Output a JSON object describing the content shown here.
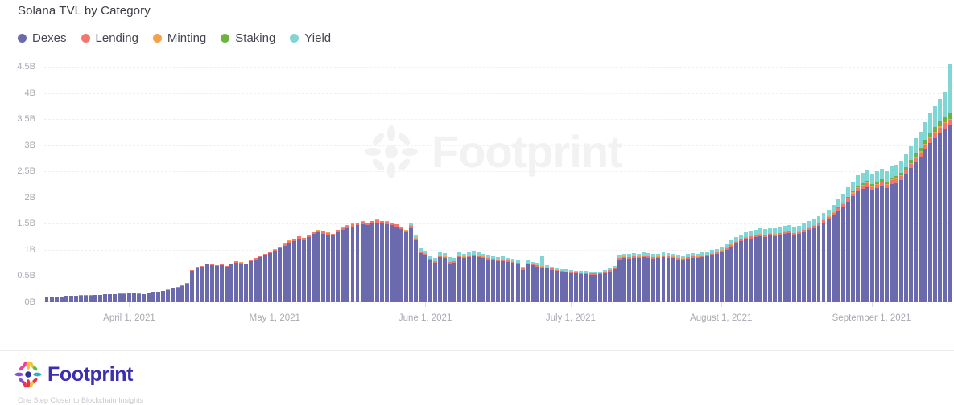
{
  "header": {
    "title": "Solana TVL by Category"
  },
  "legend": {
    "items": [
      {
        "label": "Dexes",
        "color": "#6b6aad"
      },
      {
        "label": "Lending",
        "color": "#f3766e"
      },
      {
        "label": "Minting",
        "color": "#f5a04a"
      },
      {
        "label": "Staking",
        "color": "#6cb33f"
      },
      {
        "label": "Yield",
        "color": "#7fd6d4"
      }
    ]
  },
  "watermark": {
    "text": "Footprint"
  },
  "footer": {
    "brand": "Footprint",
    "tagline": "One Step Closer to Blockchain Insights",
    "brand_color": "#3a2fae",
    "logo_colors": [
      "#8a4fd6",
      "#e8459b",
      "#f2c230",
      "#e8344a",
      "#2bb3c0",
      "#5bbf4a",
      "#2f2f9e"
    ]
  },
  "chart_data": {
    "type": "bar",
    "stacked": true,
    "title": "Solana TVL by Category",
    "xlabel": "",
    "ylabel": "",
    "ylim": [
      0,
      4500000000
    ],
    "ytick_labels": [
      "0B",
      "0.5B",
      "1B",
      "1.5B",
      "2B",
      "2.5B",
      "3B",
      "3.5B",
      "4B",
      "4.5B"
    ],
    "ytick_values": [
      0,
      500000000,
      1000000000,
      1500000000,
      2000000000,
      2500000000,
      3000000000,
      3500000000,
      4000000000,
      4500000000
    ],
    "grid": true,
    "grid_style": "dashed",
    "legend_position": "top-left",
    "x_tick_labels": [
      "April 1, 2021",
      "May 1, 2021",
      "June 1, 2021",
      "July 1, 2021",
      "August 1, 2021",
      "September 1, 2021"
    ],
    "x_tick_indices": [
      17,
      47,
      78,
      108,
      139,
      170
    ],
    "value_unit": "B",
    "series": [
      {
        "name": "Dexes",
        "color": "#6b6aad",
        "values": [
          0.1,
          0.1,
          0.11,
          0.11,
          0.12,
          0.12,
          0.12,
          0.13,
          0.13,
          0.13,
          0.14,
          0.14,
          0.15,
          0.15,
          0.15,
          0.16,
          0.16,
          0.17,
          0.17,
          0.16,
          0.15,
          0.17,
          0.18,
          0.19,
          0.21,
          0.23,
          0.26,
          0.28,
          0.31,
          0.36,
          0.6,
          0.66,
          0.68,
          0.72,
          0.7,
          0.69,
          0.71,
          0.68,
          0.72,
          0.76,
          0.74,
          0.72,
          0.78,
          0.82,
          0.86,
          0.9,
          0.93,
          0.98,
          1.03,
          1.08,
          1.14,
          1.17,
          1.22,
          1.19,
          1.24,
          1.3,
          1.33,
          1.31,
          1.29,
          1.27,
          1.34,
          1.38,
          1.42,
          1.45,
          1.47,
          1.49,
          1.47,
          1.5,
          1.52,
          1.5,
          1.49,
          1.47,
          1.44,
          1.4,
          1.33,
          1.42,
          1.18,
          0.93,
          0.9,
          0.8,
          0.76,
          0.86,
          0.84,
          0.74,
          0.76,
          0.86,
          0.84,
          0.86,
          0.88,
          0.86,
          0.84,
          0.82,
          0.8,
          0.78,
          0.79,
          0.77,
          0.75,
          0.73,
          0.62,
          0.72,
          0.7,
          0.68,
          0.66,
          0.64,
          0.62,
          0.6,
          0.58,
          0.57,
          0.56,
          0.55,
          0.54,
          0.54,
          0.53,
          0.53,
          0.54,
          0.56,
          0.59,
          0.63,
          0.82,
          0.84,
          0.83,
          0.85,
          0.84,
          0.86,
          0.85,
          0.83,
          0.84,
          0.86,
          0.85,
          0.84,
          0.82,
          0.81,
          0.83,
          0.85,
          0.84,
          0.86,
          0.88,
          0.9,
          0.92,
          0.96,
          1.0,
          1.06,
          1.12,
          1.16,
          1.2,
          1.22,
          1.24,
          1.26,
          1.25,
          1.27,
          1.26,
          1.28,
          1.3,
          1.32,
          1.28,
          1.3,
          1.34,
          1.38,
          1.42,
          1.46,
          1.52,
          1.58,
          1.66,
          1.74,
          1.82,
          1.92,
          2.02,
          2.12,
          2.16,
          2.2,
          2.14,
          2.18,
          2.22,
          2.18,
          2.26,
          2.28,
          2.34,
          2.44,
          2.56,
          2.68,
          2.78,
          2.92,
          3.04,
          3.14,
          3.24,
          3.32,
          3.38
        ]
      },
      {
        "name": "Lending",
        "color": "#f3766e",
        "values": [
          0.004,
          0.004,
          0.004,
          0.004,
          0.004,
          0.004,
          0.004,
          0.004,
          0.004,
          0.004,
          0.004,
          0.004,
          0.005,
          0.005,
          0.005,
          0.005,
          0.005,
          0.005,
          0.005,
          0.005,
          0.005,
          0.005,
          0.006,
          0.006,
          0.006,
          0.007,
          0.007,
          0.008,
          0.008,
          0.009,
          0.012,
          0.013,
          0.014,
          0.015,
          0.015,
          0.015,
          0.016,
          0.015,
          0.016,
          0.017,
          0.017,
          0.016,
          0.018,
          0.019,
          0.02,
          0.021,
          0.022,
          0.024,
          0.026,
          0.028,
          0.03,
          0.031,
          0.033,
          0.032,
          0.034,
          0.036,
          0.038,
          0.037,
          0.036,
          0.035,
          0.038,
          0.04,
          0.042,
          0.044,
          0.045,
          0.046,
          0.045,
          0.047,
          0.048,
          0.047,
          0.046,
          0.045,
          0.044,
          0.042,
          0.04,
          0.043,
          0.036,
          0.028,
          0.027,
          0.024,
          0.023,
          0.026,
          0.025,
          0.022,
          0.023,
          0.026,
          0.025,
          0.026,
          0.027,
          0.026,
          0.025,
          0.025,
          0.024,
          0.023,
          0.024,
          0.023,
          0.022,
          0.022,
          0.019,
          0.022,
          0.021,
          0.02,
          0.02,
          0.019,
          0.019,
          0.018,
          0.017,
          0.017,
          0.017,
          0.016,
          0.016,
          0.016,
          0.016,
          0.016,
          0.016,
          0.017,
          0.018,
          0.019,
          0.025,
          0.025,
          0.025,
          0.026,
          0.025,
          0.026,
          0.026,
          0.025,
          0.025,
          0.026,
          0.026,
          0.025,
          0.025,
          0.024,
          0.025,
          0.026,
          0.025,
          0.026,
          0.027,
          0.027,
          0.028,
          0.029,
          0.03,
          0.032,
          0.034,
          0.035,
          0.036,
          0.037,
          0.037,
          0.038,
          0.038,
          0.038,
          0.038,
          0.038,
          0.039,
          0.04,
          0.038,
          0.039,
          0.04,
          0.041,
          0.043,
          0.044,
          0.046,
          0.047,
          0.05,
          0.052,
          0.055,
          0.058,
          0.061,
          0.064,
          0.065,
          0.066,
          0.064,
          0.065,
          0.067,
          0.065,
          0.068,
          0.068,
          0.07,
          0.073,
          0.077,
          0.08,
          0.083,
          0.088,
          0.091,
          0.094,
          0.097,
          0.1,
          0.101
        ]
      },
      {
        "name": "Minting",
        "color": "#f5a04a",
        "values": [
          0.001,
          0.001,
          0.001,
          0.001,
          0.001,
          0.001,
          0.001,
          0.001,
          0.001,
          0.001,
          0.001,
          0.001,
          0.001,
          0.001,
          0.001,
          0.001,
          0.001,
          0.001,
          0.001,
          0.001,
          0.001,
          0.001,
          0.001,
          0.001,
          0.001,
          0.002,
          0.002,
          0.002,
          0.002,
          0.002,
          0.003,
          0.003,
          0.003,
          0.003,
          0.003,
          0.003,
          0.004,
          0.003,
          0.004,
          0.004,
          0.004,
          0.004,
          0.004,
          0.004,
          0.005,
          0.005,
          0.005,
          0.005,
          0.006,
          0.006,
          0.007,
          0.007,
          0.007,
          0.007,
          0.008,
          0.008,
          0.008,
          0.008,
          0.008,
          0.008,
          0.008,
          0.009,
          0.009,
          0.01,
          0.01,
          0.01,
          0.01,
          0.01,
          0.011,
          0.01,
          0.01,
          0.01,
          0.01,
          0.009,
          0.009,
          0.01,
          0.008,
          0.006,
          0.006,
          0.005,
          0.005,
          0.006,
          0.006,
          0.005,
          0.005,
          0.006,
          0.006,
          0.006,
          0.006,
          0.006,
          0.006,
          0.006,
          0.005,
          0.005,
          0.005,
          0.005,
          0.005,
          0.005,
          0.004,
          0.005,
          0.005,
          0.005,
          0.004,
          0.004,
          0.004,
          0.004,
          0.004,
          0.004,
          0.004,
          0.004,
          0.004,
          0.004,
          0.004,
          0.004,
          0.004,
          0.004,
          0.004,
          0.004,
          0.006,
          0.006,
          0.006,
          0.006,
          0.006,
          0.006,
          0.006,
          0.006,
          0.006,
          0.006,
          0.006,
          0.006,
          0.006,
          0.006,
          0.006,
          0.006,
          0.006,
          0.006,
          0.006,
          0.007,
          0.007,
          0.007,
          0.008,
          0.008,
          0.009,
          0.009,
          0.009,
          0.009,
          0.009,
          0.01,
          0.01,
          0.01,
          0.01,
          0.01,
          0.01,
          0.01,
          0.01,
          0.01,
          0.01,
          0.011,
          0.011,
          0.011,
          0.012,
          0.012,
          0.013,
          0.013,
          0.014,
          0.015,
          0.016,
          0.016,
          0.017,
          0.017,
          0.016,
          0.017,
          0.017,
          0.017,
          0.017,
          0.018,
          0.018,
          0.019,
          0.02,
          0.021,
          0.021,
          0.022,
          0.023,
          0.024,
          0.025,
          0.026,
          0.026
        ]
      },
      {
        "name": "Staking",
        "color": "#6cb33f",
        "values": [
          0.0,
          0.0,
          0.0,
          0.0,
          0.0,
          0.0,
          0.0,
          0.0,
          0.0,
          0.0,
          0.0,
          0.0,
          0.0,
          0.0,
          0.0,
          0.0,
          0.0,
          0.0,
          0.0,
          0.0,
          0.0,
          0.0,
          0.0,
          0.0,
          0.0,
          0.0,
          0.0,
          0.0,
          0.0,
          0.0,
          0.0,
          0.0,
          0.0,
          0.0,
          0.0,
          0.0,
          0.0,
          0.0,
          0.0,
          0.0,
          0.0,
          0.0,
          0.0,
          0.0,
          0.0,
          0.0,
          0.0,
          0.0,
          0.0,
          0.0,
          0.0,
          0.0,
          0.0,
          0.0,
          0.0,
          0.0,
          0.0,
          0.0,
          0.0,
          0.0,
          0.0,
          0.0,
          0.0,
          0.0,
          0.0,
          0.0,
          0.0,
          0.0,
          0.0,
          0.0,
          0.0,
          0.0,
          0.0,
          0.0,
          0.0,
          0.0,
          0.0,
          0.0,
          0.0,
          0.0,
          0.0,
          0.0,
          0.0,
          0.0,
          0.0,
          0.0,
          0.0,
          0.0,
          0.0,
          0.0,
          0.0,
          0.0,
          0.0,
          0.0,
          0.0,
          0.0,
          0.0,
          0.0,
          0.0,
          0.0,
          0.0,
          0.0,
          0.0,
          0.0,
          0.0,
          0.0,
          0.0,
          0.0,
          0.0,
          0.0,
          0.0,
          0.0,
          0.0,
          0.0,
          0.0,
          0.0,
          0.0,
          0.0,
          0.0,
          0.0,
          0.0,
          0.0,
          0.0,
          0.0,
          0.0,
          0.0,
          0.0,
          0.0,
          0.0,
          0.0,
          0.0,
          0.0,
          0.0,
          0.0,
          0.0,
          0.0,
          0.0,
          0.0,
          0.0,
          0.0,
          0.0,
          0.0,
          0.0,
          0.0,
          0.0,
          0.0,
          0.0,
          0.0,
          0.0,
          0.0,
          0.0,
          0.0,
          0.0,
          0.0,
          0.0,
          0.0,
          0.0,
          0.0,
          0.0,
          0.0,
          0.0,
          0.0,
          0.0,
          0.018,
          0.022,
          0.026,
          0.03,
          0.034,
          0.036,
          0.038,
          0.036,
          0.038,
          0.04,
          0.038,
          0.042,
          0.044,
          0.048,
          0.052,
          0.058,
          0.064,
          0.07,
          0.076,
          0.082,
          0.088,
          0.094,
          0.1,
          0.104
        ]
      },
      {
        "name": "Yield",
        "color": "#7fd6d4",
        "values": [
          0.0,
          0.0,
          0.0,
          0.0,
          0.0,
          0.0,
          0.0,
          0.0,
          0.0,
          0.0,
          0.0,
          0.0,
          0.0,
          0.0,
          0.0,
          0.0,
          0.0,
          0.0,
          0.0,
          0.0,
          0.0,
          0.0,
          0.0,
          0.0,
          0.0,
          0.0,
          0.0,
          0.0,
          0.0,
          0.0,
          0.0,
          0.0,
          0.0,
          0.0,
          0.0,
          0.0,
          0.0,
          0.0,
          0.0,
          0.0,
          0.0,
          0.0,
          0.0,
          0.0,
          0.0,
          0.0,
          0.0,
          0.0,
          0.0,
          0.0,
          0.0,
          0.0,
          0.0,
          0.0,
          0.0,
          0.0,
          0.0,
          0.0,
          0.0,
          0.0,
          0.0,
          0.0,
          0.0,
          0.0,
          0.0,
          0.0,
          0.0,
          0.0,
          0.0,
          0.0,
          0.0,
          0.0,
          0.0,
          0.0,
          0.0,
          0.04,
          0.06,
          0.07,
          0.05,
          0.06,
          0.05,
          0.07,
          0.06,
          0.09,
          0.05,
          0.06,
          0.055,
          0.06,
          0.065,
          0.06,
          0.055,
          0.055,
          0.05,
          0.05,
          0.055,
          0.05,
          0.048,
          0.046,
          0.04,
          0.048,
          0.046,
          0.044,
          0.19,
          0.042,
          0.04,
          0.038,
          0.036,
          0.036,
          0.035,
          0.034,
          0.033,
          0.032,
          0.032,
          0.031,
          0.031,
          0.032,
          0.033,
          0.035,
          0.055,
          0.055,
          0.054,
          0.056,
          0.055,
          0.057,
          0.056,
          0.054,
          0.055,
          0.057,
          0.056,
          0.055,
          0.054,
          0.053,
          0.055,
          0.057,
          0.056,
          0.058,
          0.06,
          0.062,
          0.064,
          0.068,
          0.072,
          0.078,
          0.086,
          0.09,
          0.094,
          0.096,
          0.098,
          0.1,
          0.1,
          0.102,
          0.102,
          0.104,
          0.106,
          0.108,
          0.104,
          0.106,
          0.11,
          0.114,
          0.118,
          0.122,
          0.128,
          0.134,
          0.142,
          0.15,
          0.16,
          0.172,
          0.184,
          0.196,
          0.202,
          0.208,
          0.2,
          0.206,
          0.212,
          0.206,
          0.218,
          0.222,
          0.232,
          0.248,
          0.268,
          0.29,
          0.31,
          0.34,
          0.37,
          0.4,
          0.43,
          0.46,
          0.94
        ]
      }
    ]
  }
}
